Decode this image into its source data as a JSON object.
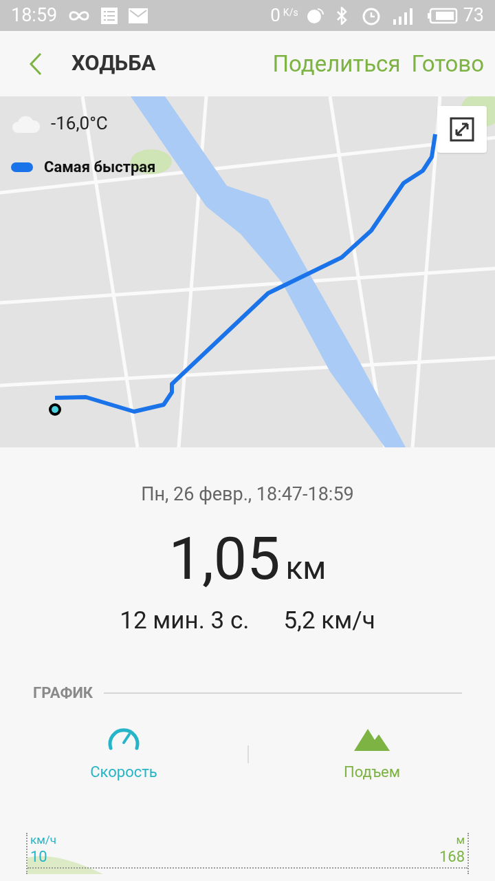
{
  "status_bar": {
    "time": "18:59",
    "net_speed": "0",
    "net_unit": "K/s",
    "battery": "73"
  },
  "header": {
    "title": "ХОДЬБА",
    "actions": [
      "Поделиться",
      "Готово"
    ]
  },
  "map": {
    "temperature": "-16,0°C",
    "legend": "Самая быстрая"
  },
  "summary": {
    "date": "Пн, 26 февр., 18:47-18:59",
    "distance": "1,05",
    "distance_unit": "км",
    "duration": "12 мин. 3 с.",
    "speed": "5,2 км/ч"
  },
  "graph": {
    "heading": "ГРАФИК",
    "tabs": [
      {
        "kind": "speed",
        "label": "Скорость"
      },
      {
        "kind": "elevation",
        "label": "Подъем"
      }
    ],
    "left_unit": "км/ч",
    "left_value": "10",
    "right_unit": "м",
    "right_value": "168"
  }
}
